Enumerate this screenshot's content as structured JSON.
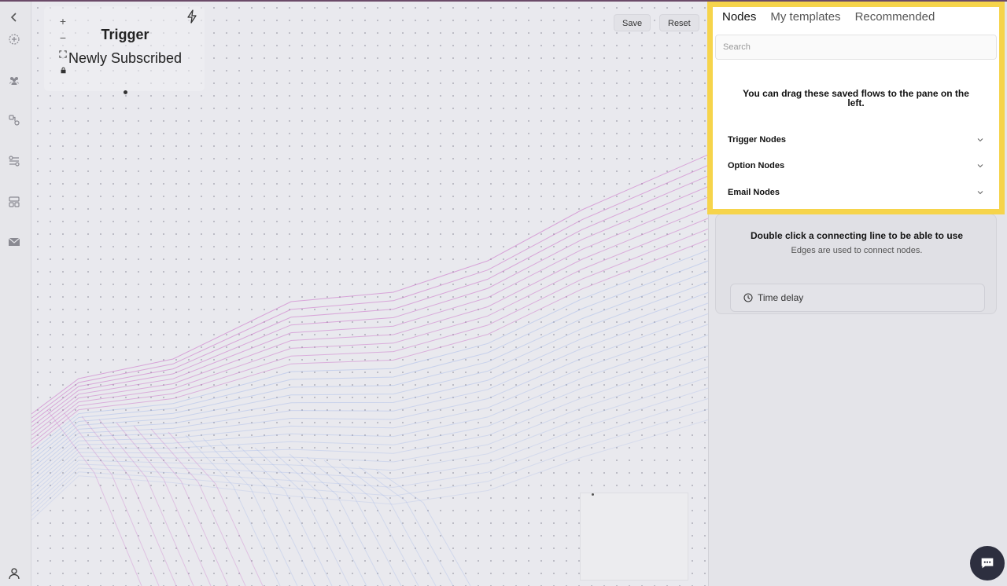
{
  "canvas": {
    "trigger_title": "Trigger",
    "trigger_subtitle": "Newly Subscribed",
    "zoom_in_symbol": "+",
    "zoom_out_symbol": "−",
    "save_label": "Save",
    "reset_label": "Reset"
  },
  "sidebar": {
    "tabs": [
      "Nodes",
      "My templates",
      "Recommended"
    ],
    "search_placeholder": "Search",
    "hint": "You can drag these saved flows to the pane on the left.",
    "sections": [
      "Trigger Nodes",
      "Option Nodes",
      "Email Nodes"
    ],
    "edges_title": "Double click a connecting line to be able to use",
    "edges_subtitle": "Edges are used to connect nodes.",
    "time_delay_label": "Time delay"
  },
  "rail_icons": [
    "collapse-icon",
    "add-circle-icon",
    "audience-icon",
    "flow-nodes-icon",
    "settings-sliders-icon",
    "templates-icon",
    "mail-icon",
    "user-icon"
  ],
  "colors": {
    "highlight": "#f6d44b",
    "wave_pink": "#c34fbf",
    "wave_blue": "#8aa6e8"
  }
}
